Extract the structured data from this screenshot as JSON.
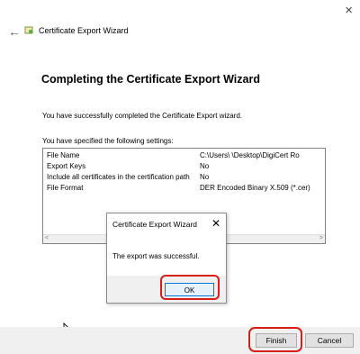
{
  "window": {
    "close_glyph": "×"
  },
  "header": {
    "wizard_title": "Certificate Export Wizard",
    "back_glyph": "←"
  },
  "main": {
    "title": "Completing the Certificate Export Wizard",
    "success_text": "You have successfully completed the Certificate Export wizard.",
    "settings_label": "You have specified the following settings:",
    "settings": [
      {
        "key": "File Name",
        "value": "C:\\Users\\          \\Desktop\\DigiCert Ro"
      },
      {
        "key": "Export Keys",
        "value": "No"
      },
      {
        "key": "Include all certificates in the certification path",
        "value": "No"
      },
      {
        "key": "File Format",
        "value": "DER Encoded Binary X.509 (*.cer)"
      }
    ],
    "scroll_left": "<",
    "scroll_right": ">"
  },
  "dialog": {
    "title": "Certificate Export Wizard",
    "close_glyph": "✕",
    "message": "The export was successful.",
    "ok_label": "OK"
  },
  "footer": {
    "finish_label": "Finish",
    "cancel_label": "Cancel"
  },
  "colors": {
    "highlight": "#d91e18",
    "accent": "#0078d7",
    "footer_bg": "#f0f0f0"
  },
  "icons": {
    "wizard": "certificate-icon",
    "cursor": "mouse-pointer-icon"
  }
}
